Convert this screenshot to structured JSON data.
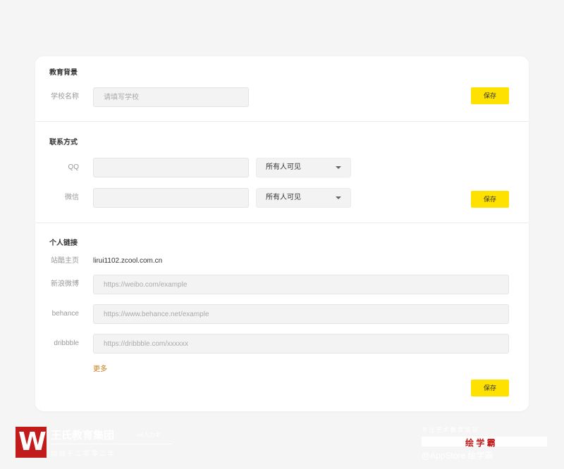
{
  "education": {
    "title": "教育背景",
    "school_label": "学校名称",
    "school_placeholder": "请填写学校",
    "save_label": "保存"
  },
  "contact": {
    "title": "联系方式",
    "qq_label": "QQ",
    "qq_value": "",
    "qq_visibility": "所有人可见",
    "wechat_label": "微信",
    "wechat_value": "",
    "wechat_visibility": "所有人可见",
    "save_label": "保存"
  },
  "links": {
    "title": "个人链接",
    "zcool_label": "站酷主页",
    "zcool_value": "lirui1102.zcool.com.cn",
    "weibo_label": "新浪微博",
    "weibo_placeholder": "https://weibo.com/example",
    "behance_label": "behance",
    "behance_placeholder": "https://www.behance.net/example",
    "dribbble_label": "dribbble",
    "dribbble_placeholder": "https://dribbble.com/xxxxxx",
    "more_label": "更多",
    "save_label": "保存"
  },
  "watermark": {
    "logo_letter": "W",
    "group_name": "王氏教育集团",
    "group_tag": "ux人力本",
    "group_sub": "始 创 于 二 零 零 二 年",
    "right_brand": "绘 学 霸",
    "right_line1": "专 注 艺 术 教 育 培 训",
    "right_line2": "@AppStore 绘学霸"
  },
  "colors": {
    "accent_yellow": "#ffe100",
    "link_orange": "#c97d1b",
    "logo_red": "#c21b1b"
  }
}
